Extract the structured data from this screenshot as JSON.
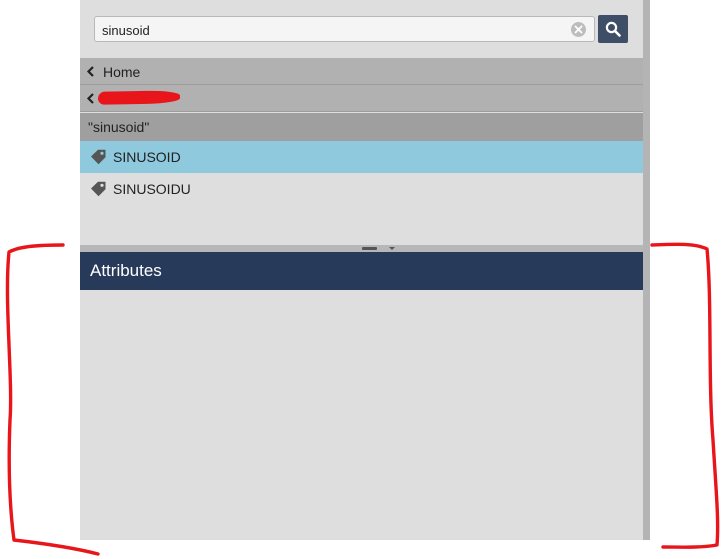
{
  "search": {
    "value": "sinusoid"
  },
  "breadcrumbs": {
    "home_label": "Home",
    "query_label": "\"sinusoid\""
  },
  "results": [
    {
      "label": "SINUSOID",
      "selected": true
    },
    {
      "label": "SINUSOIDU",
      "selected": false
    }
  ],
  "attributes": {
    "title": "Attributes"
  },
  "colors": {
    "selected_row": "#8fc9dd",
    "header_bg": "#283a5a",
    "search_button": "#3d4e66",
    "annotation": "#e8161a"
  },
  "icons": [
    "clear-icon",
    "search-icon",
    "chevron-left-icon",
    "tag-icon"
  ]
}
